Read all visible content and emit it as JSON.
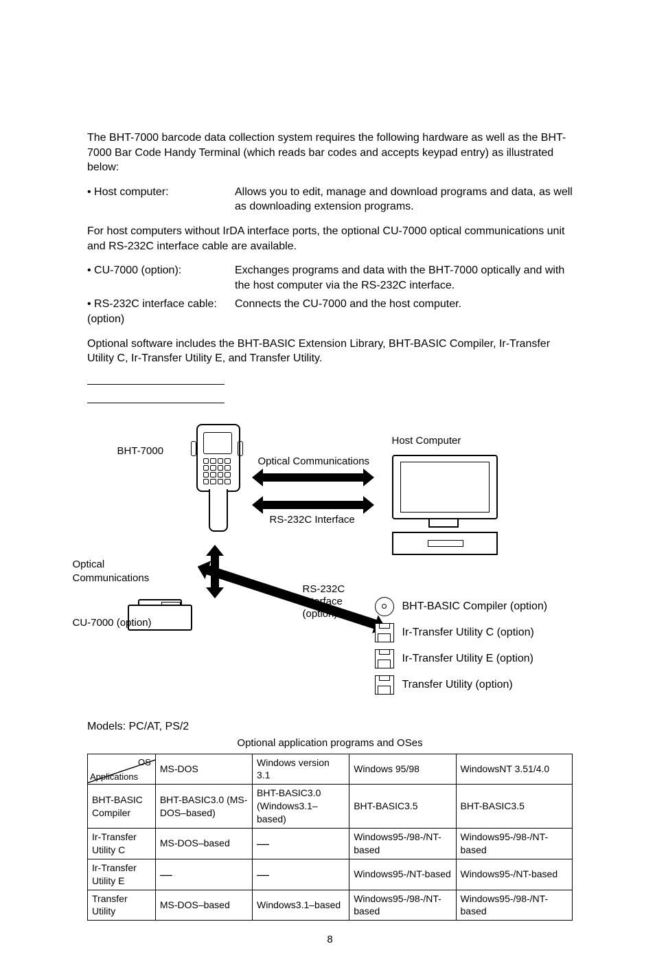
{
  "intro": "The BHT-7000 barcode data collection system requires the following hardware as well as the BHT-7000 Bar Code Handy Terminal (which reads bar codes and accepts keypad entry) as illustrated below:",
  "bullets": {
    "host": {
      "label": "•  Host computer:",
      "desc": "Allows you to edit, manage and download programs and data, as well as downloading extension programs."
    },
    "para_after_host": "For host computers without IrDA interface ports, the optional CU-7000 optical communications unit and RS-232C interface cable are available.",
    "cu": {
      "label": "•  CU-7000 (option):",
      "desc": "Exchanges programs and data with the BHT-7000 optically and with the host computer via the RS-232C interface."
    },
    "rs": {
      "label": "•  RS-232C interface cable: (option)",
      "desc": "Connects the CU-7000 and the host computer."
    }
  },
  "optional_sw": "Optional software includes the BHT-BASIC Extension Library, BHT-BASIC Compiler, Ir-Transfer Utility C, Ir-Transfer Utility E, and Transfer Utility.",
  "diagram": {
    "bht7000": "BHT-7000",
    "host": "Host Computer",
    "optical_comm": "Optical Communications",
    "rs232c": "RS-232C Interface",
    "rs232c_option": "RS-232C Interface (option)",
    "cu7000": "CU-7000 (option)",
    "sw1": "BHT-BASIC Compiler (option)",
    "sw2": "Ir-Transfer Utility C (option)",
    "sw3": "Ir-Transfer Utility E (option)",
    "sw4": "Transfer Utility (option)"
  },
  "models": "Models:  PC/AT, PS/2",
  "table_caption": "Optional application programs and OSes",
  "table": {
    "corner_os": "OS",
    "corner_app": "Applications",
    "headers": [
      "MS-DOS",
      "Windows version 3.1",
      "Windows 95/98",
      "WindowsNT 3.51/4.0"
    ],
    "rows": [
      {
        "app": "BHT-BASIC Compiler",
        "c0": "BHT-BASIC3.0 (MS-DOS–based)",
        "c1": "BHT-BASIC3.0 (Windows3.1–based)",
        "c2": "BHT-BASIC3.5",
        "c3": "BHT-BASIC3.5"
      },
      {
        "app": "Ir-Transfer Utility C",
        "c0": "MS-DOS–based",
        "c1": "—",
        "c2": "Windows95-/98-/NT-based",
        "c3": "Windows95-/98-/NT-based"
      },
      {
        "app": "Ir-Transfer Utility E",
        "c0": "—",
        "c1": "—",
        "c2": "Windows95-/NT-based",
        "c3": "Windows95-/NT-based"
      },
      {
        "app": "Transfer Utility",
        "c0": "MS-DOS–based",
        "c1": "Windows3.1–based",
        "c2": "Windows95-/98-/NT-based",
        "c3": "Windows95-/98-/NT-based"
      }
    ]
  },
  "page_number": "8"
}
